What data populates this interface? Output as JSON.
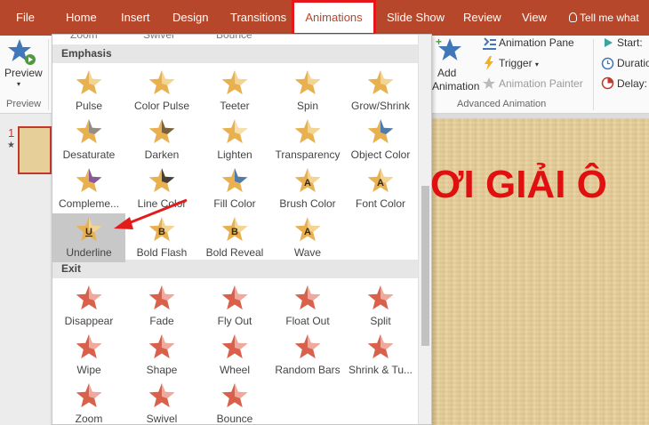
{
  "tabs": [
    {
      "label": "File"
    },
    {
      "label": "Home"
    },
    {
      "label": "Insert"
    },
    {
      "label": "Design"
    },
    {
      "label": "Transitions"
    },
    {
      "label": "Animations"
    },
    {
      "label": "Slide Show"
    },
    {
      "label": "Review"
    },
    {
      "label": "View"
    }
  ],
  "tell_me": "Tell me what",
  "ribbon": {
    "preview_label": "Preview",
    "preview_group": "Preview",
    "add_animation": [
      "Add",
      "Animation"
    ],
    "animation_pane": "Animation Pane",
    "trigger": "Trigger",
    "animation_painter": "Animation Painter",
    "advanced_group": "Advanced Animation",
    "start": "Start:",
    "duration": "Duratio",
    "delay": "Delay:"
  },
  "slide_pane": {
    "slide_number": "1"
  },
  "slide": {
    "title_text": "ƠI GIẢI Ô"
  },
  "gallery": {
    "emphasis_header": "Emphasis",
    "exit_header": "Exit",
    "top_partial": [
      "Zoom",
      "Swivel",
      "Bounce"
    ],
    "emphasis": [
      {
        "label": "Pulse",
        "icon": "pulse-star",
        "colors": [
          "#e8b04e",
          "#f5d89a"
        ]
      },
      {
        "label": "Color Pulse",
        "icon": "color-pulse-star",
        "colors": [
          "#e8b04e",
          "#f5d89a"
        ]
      },
      {
        "label": "Teeter",
        "icon": "teeter-star",
        "colors": [
          "#e8b04e",
          "#f5d89a"
        ]
      },
      {
        "label": "Spin",
        "icon": "spin-star",
        "colors": [
          "#e8b04e",
          "#f5d89a"
        ]
      },
      {
        "label": "Grow/Shrink",
        "icon": "grow-shrink-star",
        "colors": [
          "#e8b04e",
          "#f5d89a"
        ]
      },
      {
        "label": "Desaturate",
        "icon": "desaturate-star",
        "colors": [
          "#e8b04e",
          "#8a8a8a"
        ]
      },
      {
        "label": "Darken",
        "icon": "darken-star",
        "colors": [
          "#e8b04e",
          "#6e5a3c"
        ]
      },
      {
        "label": "Lighten",
        "icon": "lighten-star",
        "colors": [
          "#e8b04e",
          "#f8e4b8"
        ]
      },
      {
        "label": "Transparency",
        "icon": "transparency-star",
        "colors": [
          "#e8b04e",
          "#f5d89a"
        ]
      },
      {
        "label": "Object Color",
        "icon": "object-color-star",
        "colors": [
          "#e8b04e",
          "#3f77b8"
        ]
      },
      {
        "label": "Compleme...",
        "icon": "complementary-star",
        "colors": [
          "#e8b04e",
          "#7e4fa0"
        ]
      },
      {
        "label": "Line Color",
        "icon": "line-color-star",
        "colors": [
          "#e8b04e",
          "#333333"
        ]
      },
      {
        "label": "Fill Color",
        "icon": "fill-color-star",
        "colors": [
          "#e8b04e",
          "#3f77b8"
        ]
      },
      {
        "label": "Brush Color",
        "icon": "brush-color-star",
        "colors": [
          "#e8b04e",
          "#f5d89a"
        ],
        "letter": "A"
      },
      {
        "label": "Font Color",
        "icon": "font-color-star",
        "colors": [
          "#e8b04e",
          "#f5d89a"
        ],
        "letter": "A"
      },
      {
        "label": "Underline",
        "icon": "underline-star",
        "colors": [
          "#e8b04e",
          "#f5d89a"
        ],
        "letter": "U",
        "selected": true
      },
      {
        "label": "Bold Flash",
        "icon": "bold-flash-star",
        "colors": [
          "#e8b04e",
          "#f5d89a"
        ],
        "letter": "B"
      },
      {
        "label": "Bold Reveal",
        "icon": "bold-reveal-star",
        "colors": [
          "#e8b04e",
          "#f5d89a"
        ],
        "letter": "B"
      },
      {
        "label": "Wave",
        "icon": "wave-star",
        "colors": [
          "#e8b04e",
          "#f5d89a"
        ],
        "letter": "A"
      }
    ],
    "exit": [
      {
        "label": "Disappear",
        "icon": "disappear-star",
        "colors": [
          "#d9614b",
          "#f2b3a6"
        ]
      },
      {
        "label": "Fade",
        "icon": "fade-star",
        "colors": [
          "#d9614b",
          "#f2b3a6"
        ]
      },
      {
        "label": "Fly Out",
        "icon": "fly-out-star",
        "colors": [
          "#d9614b",
          "#f2b3a6"
        ]
      },
      {
        "label": "Float Out",
        "icon": "float-out-star",
        "colors": [
          "#d9614b",
          "#f2b3a6"
        ]
      },
      {
        "label": "Split",
        "icon": "split-star",
        "colors": [
          "#d9614b",
          "#f2b3a6"
        ]
      },
      {
        "label": "Wipe",
        "icon": "wipe-star",
        "colors": [
          "#d9614b",
          "#f2b3a6"
        ]
      },
      {
        "label": "Shape",
        "icon": "shape-star",
        "colors": [
          "#d9614b",
          "#f2b3a6"
        ]
      },
      {
        "label": "Wheel",
        "icon": "wheel-star",
        "colors": [
          "#d9614b",
          "#f2b3a6"
        ]
      },
      {
        "label": "Random Bars",
        "icon": "random-bars-star",
        "colors": [
          "#d9614b",
          "#f2b3a6"
        ]
      },
      {
        "label": "Shrink & Tu...",
        "icon": "shrink-turn-star",
        "colors": [
          "#d9614b",
          "#f2b3a6"
        ]
      },
      {
        "label": "Zoom",
        "icon": "zoom-star",
        "colors": [
          "#d9614b",
          "#f2b3a6"
        ]
      },
      {
        "label": "Swivel",
        "icon": "swivel-star",
        "colors": [
          "#d9614b",
          "#f2b3a6"
        ]
      },
      {
        "label": "Bounce",
        "icon": "bounce-star",
        "colors": [
          "#d9614b",
          "#f2b3a6"
        ]
      }
    ]
  },
  "colors": {
    "ribbon_red": "#b7472a",
    "highlight_box": "#e8151b",
    "arrow": "#e21b1b",
    "slide_title": "#e01010"
  }
}
